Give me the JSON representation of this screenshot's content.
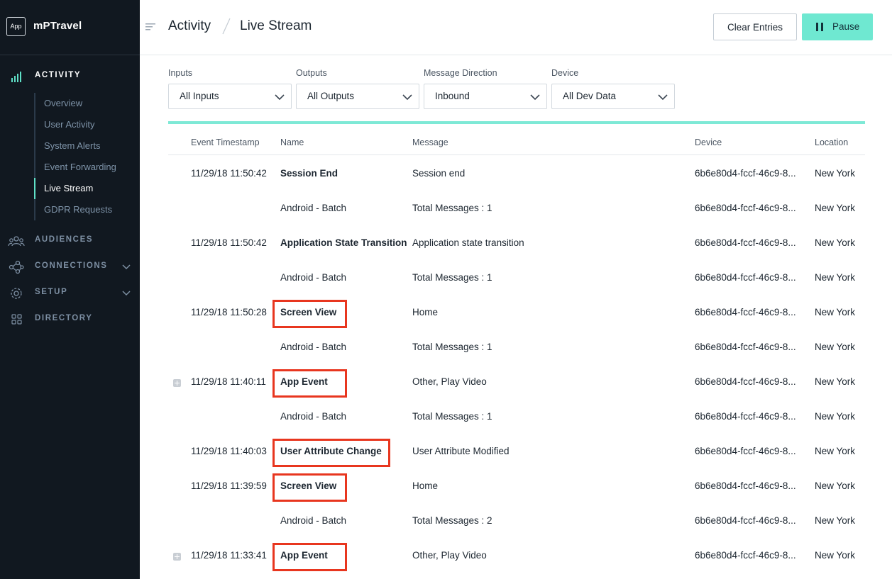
{
  "app": {
    "badge": "App",
    "name": "mPTravel"
  },
  "sidebar": {
    "sections": [
      {
        "label": "ACTIVITY",
        "icon": "activity-bars-icon",
        "active": true
      },
      {
        "label": "AUDIENCES",
        "icon": "people-icon"
      },
      {
        "label": "CONNECTIONS",
        "icon": "connections-icon",
        "expandable": true
      },
      {
        "label": "SETUP",
        "icon": "gear-icon",
        "expandable": true
      },
      {
        "label": "DIRECTORY",
        "icon": "grid-icon"
      }
    ],
    "activity_items": [
      {
        "label": "Overview"
      },
      {
        "label": "User Activity"
      },
      {
        "label": "System Alerts"
      },
      {
        "label": "Event Forwarding"
      },
      {
        "label": "Live Stream",
        "active": true
      },
      {
        "label": "GDPR Requests"
      }
    ]
  },
  "header": {
    "breadcrumb": [
      "Activity",
      "Live Stream"
    ],
    "clear_label": "Clear Entries",
    "pause_label": "Pause"
  },
  "filters": [
    {
      "label": "Inputs",
      "value": "All Inputs"
    },
    {
      "label": "Outputs",
      "value": "All Outputs"
    },
    {
      "label": "Message Direction",
      "value": "Inbound"
    },
    {
      "label": "Device",
      "value": "All Dev Data"
    }
  ],
  "table": {
    "columns": [
      "Event Timestamp",
      "Name",
      "Message",
      "Device",
      "Location"
    ],
    "rows": [
      {
        "ts": "11/29/18 11:50:42",
        "name": "Session End",
        "bold": true,
        "msg": "Session end",
        "dev": "6b6e80d4-fccf-46c9-8...",
        "loc": "New York"
      },
      {
        "ts": "",
        "name": "Android - Batch",
        "bold": false,
        "msg": "Total Messages : 1",
        "dev": "6b6e80d4-fccf-46c9-8...",
        "loc": "New York"
      },
      {
        "ts": "11/29/18 11:50:42",
        "name": "Application State Transition",
        "bold": true,
        "msg": "Application state transition",
        "dev": "6b6e80d4-fccf-46c9-8...",
        "loc": "New York"
      },
      {
        "ts": "",
        "name": "Android - Batch",
        "bold": false,
        "msg": "Total Messages : 1",
        "dev": "6b6e80d4-fccf-46c9-8...",
        "loc": "New York"
      },
      {
        "ts": "11/29/18 11:50:28",
        "name": "Screen View",
        "bold": true,
        "highlight": true,
        "msg": "Home",
        "dev": "6b6e80d4-fccf-46c9-8...",
        "loc": "New York"
      },
      {
        "ts": "",
        "name": "Android - Batch",
        "bold": false,
        "msg": "Total Messages : 1",
        "dev": "6b6e80d4-fccf-46c9-8...",
        "loc": "New York"
      },
      {
        "ts": "11/29/18 11:40:11",
        "name": "App Event",
        "bold": true,
        "highlight": true,
        "expand": true,
        "msg": "Other, Play Video",
        "dev": "6b6e80d4-fccf-46c9-8...",
        "loc": "New York"
      },
      {
        "ts": "",
        "name": "Android - Batch",
        "bold": false,
        "msg": "Total Messages : 1",
        "dev": "6b6e80d4-fccf-46c9-8...",
        "loc": "New York"
      },
      {
        "ts": "11/29/18 11:40:03",
        "name": "User Attribute Change",
        "bold": true,
        "highlight": true,
        "msg": "User Attribute Modified",
        "dev": "6b6e80d4-fccf-46c9-8...",
        "loc": "New York"
      },
      {
        "ts": "11/29/18 11:39:59",
        "name": "Screen View",
        "bold": true,
        "highlight": true,
        "msg": "Home",
        "dev": "6b6e80d4-fccf-46c9-8...",
        "loc": "New York"
      },
      {
        "ts": "",
        "name": "Android - Batch",
        "bold": false,
        "msg": "Total Messages : 2",
        "dev": "6b6e80d4-fccf-46c9-8...",
        "loc": "New York"
      },
      {
        "ts": "11/29/18 11:33:41",
        "name": "App Event",
        "bold": true,
        "highlight": true,
        "expand": true,
        "msg": "Other, Play Video",
        "dev": "6b6e80d4-fccf-46c9-8...",
        "loc": "New York"
      }
    ]
  },
  "colors": {
    "sidebar_bg": "#111820",
    "accent": "#6fe8d1",
    "highlight_border": "#e8361f"
  }
}
